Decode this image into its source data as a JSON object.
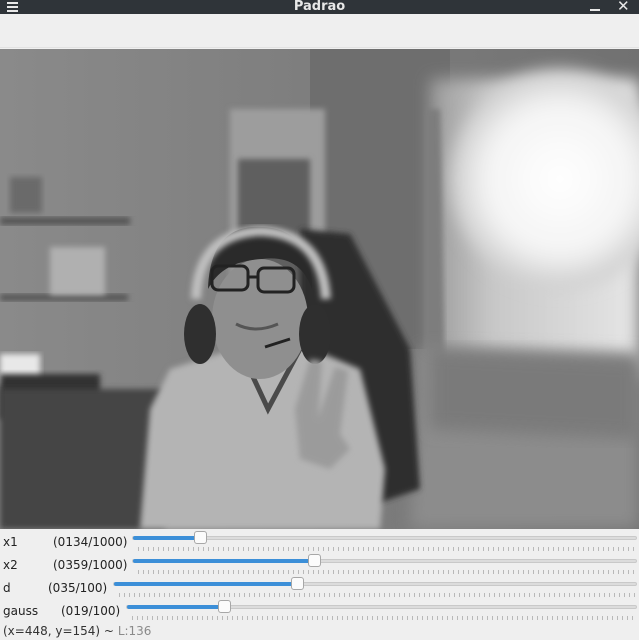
{
  "window": {
    "title": "Padrao"
  },
  "icons": {
    "menu": "hamburger-menu-icon",
    "minimize": "minimize-icon",
    "close": "close-icon",
    "close_glyph": "✕"
  },
  "colors": {
    "titlebar": "#2f3439",
    "accent": "#3c8fd8"
  },
  "image": {
    "description": "grayscale webcam frame"
  },
  "trackbars": [
    {
      "label": "x1",
      "value_text": "(0134/1000)",
      "value": 134,
      "max": 1000
    },
    {
      "label": "x2",
      "value_text": "(0359/1000)",
      "value": 359,
      "max": 1000
    },
    {
      "label": "d",
      "value_text": "(035/100)",
      "value": 35,
      "max": 100
    },
    {
      "label": "gauss",
      "value_text": "(019/100)",
      "value": 19,
      "max": 100
    }
  ],
  "status": {
    "coords": "(x=448, y=154) ~",
    "luminance": "L:136"
  }
}
